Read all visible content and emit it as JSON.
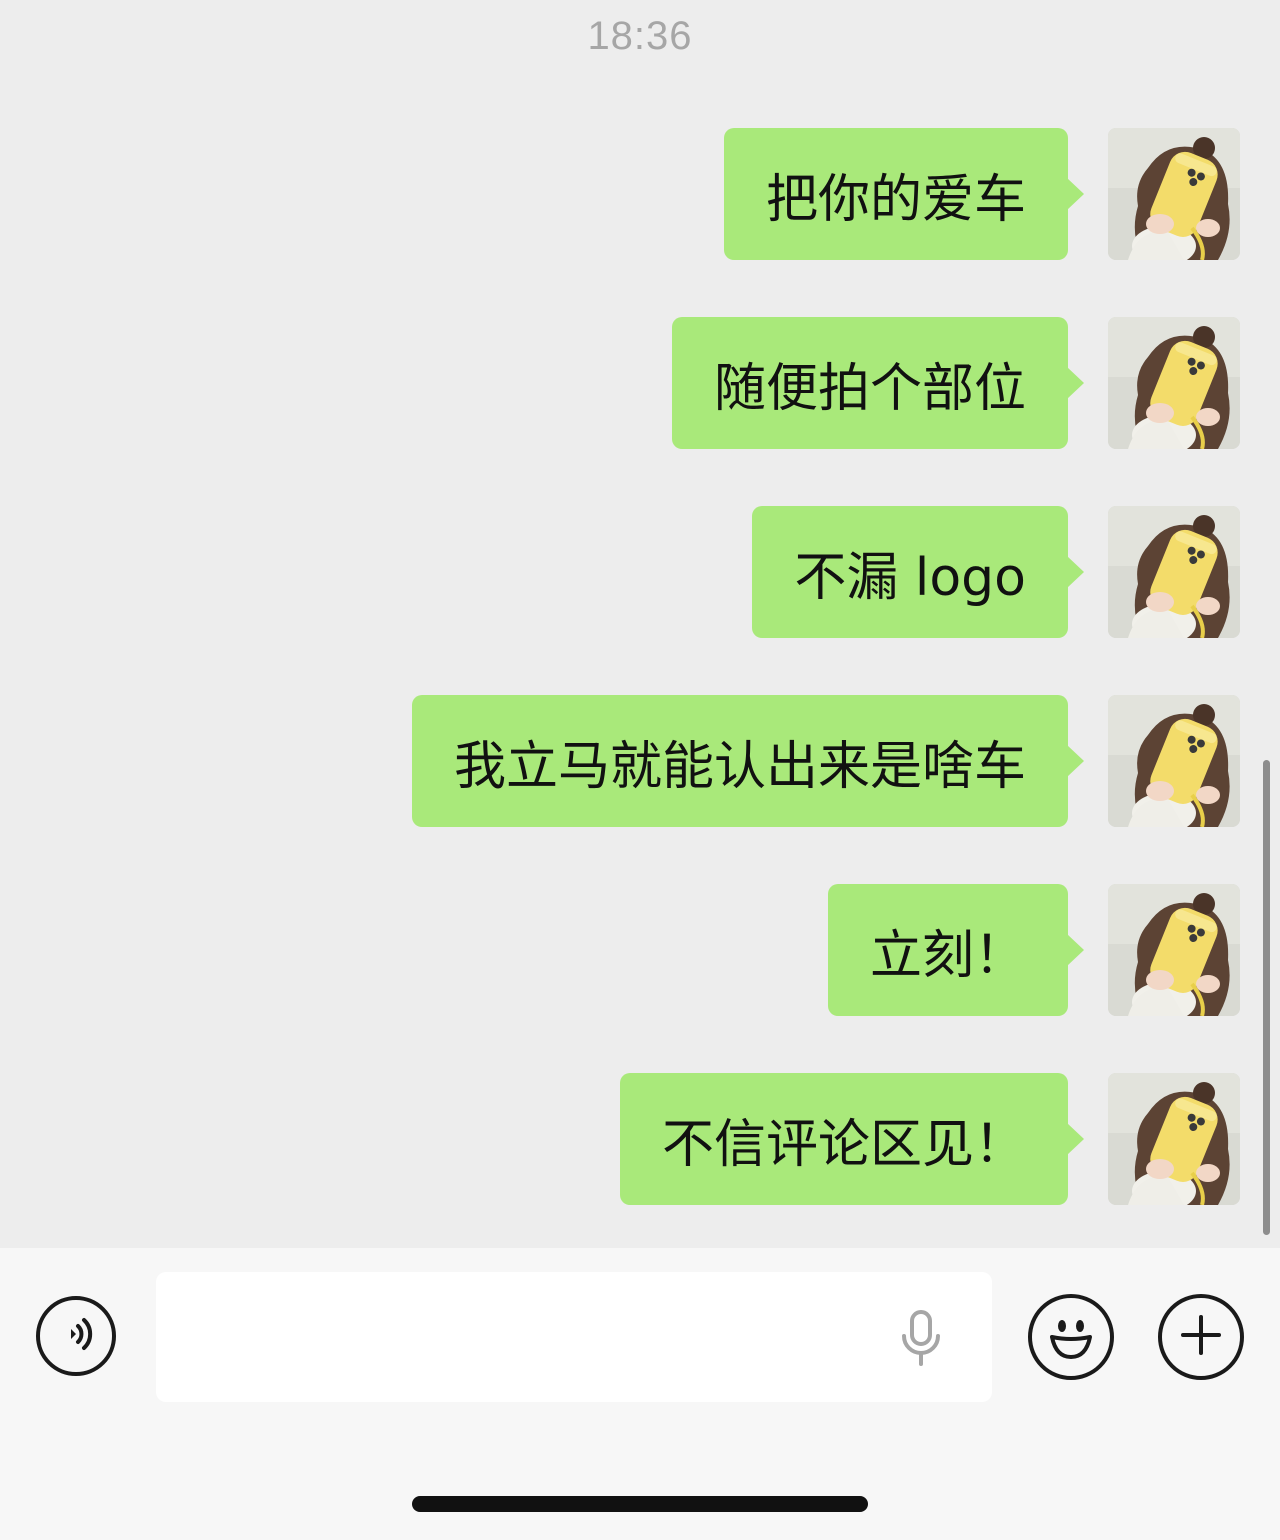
{
  "status": {
    "time": "18:36"
  },
  "messages": [
    {
      "text": "把你的爱车",
      "sender": "me"
    },
    {
      "text": "随便拍个部位",
      "sender": "me"
    },
    {
      "text": "不漏 logo",
      "sender": "me"
    },
    {
      "text": "我立马就能认出来是啥车",
      "sender": "me"
    },
    {
      "text": "立刻！",
      "sender": "me"
    },
    {
      "text": "不信评论区见！",
      "sender": "me"
    }
  ],
  "input": {
    "value": "",
    "placeholder": ""
  },
  "icons": {
    "voice": "voice-wave-icon",
    "mic": "microphone-icon",
    "emoji": "smiley-face-icon",
    "more": "plus-circle-icon"
  },
  "colors": {
    "chat_background": "#ededed",
    "bubble_sent": "#a9e97a",
    "input_bar": "#f7f7f7",
    "timestamp_text": "#a6a6a6"
  }
}
